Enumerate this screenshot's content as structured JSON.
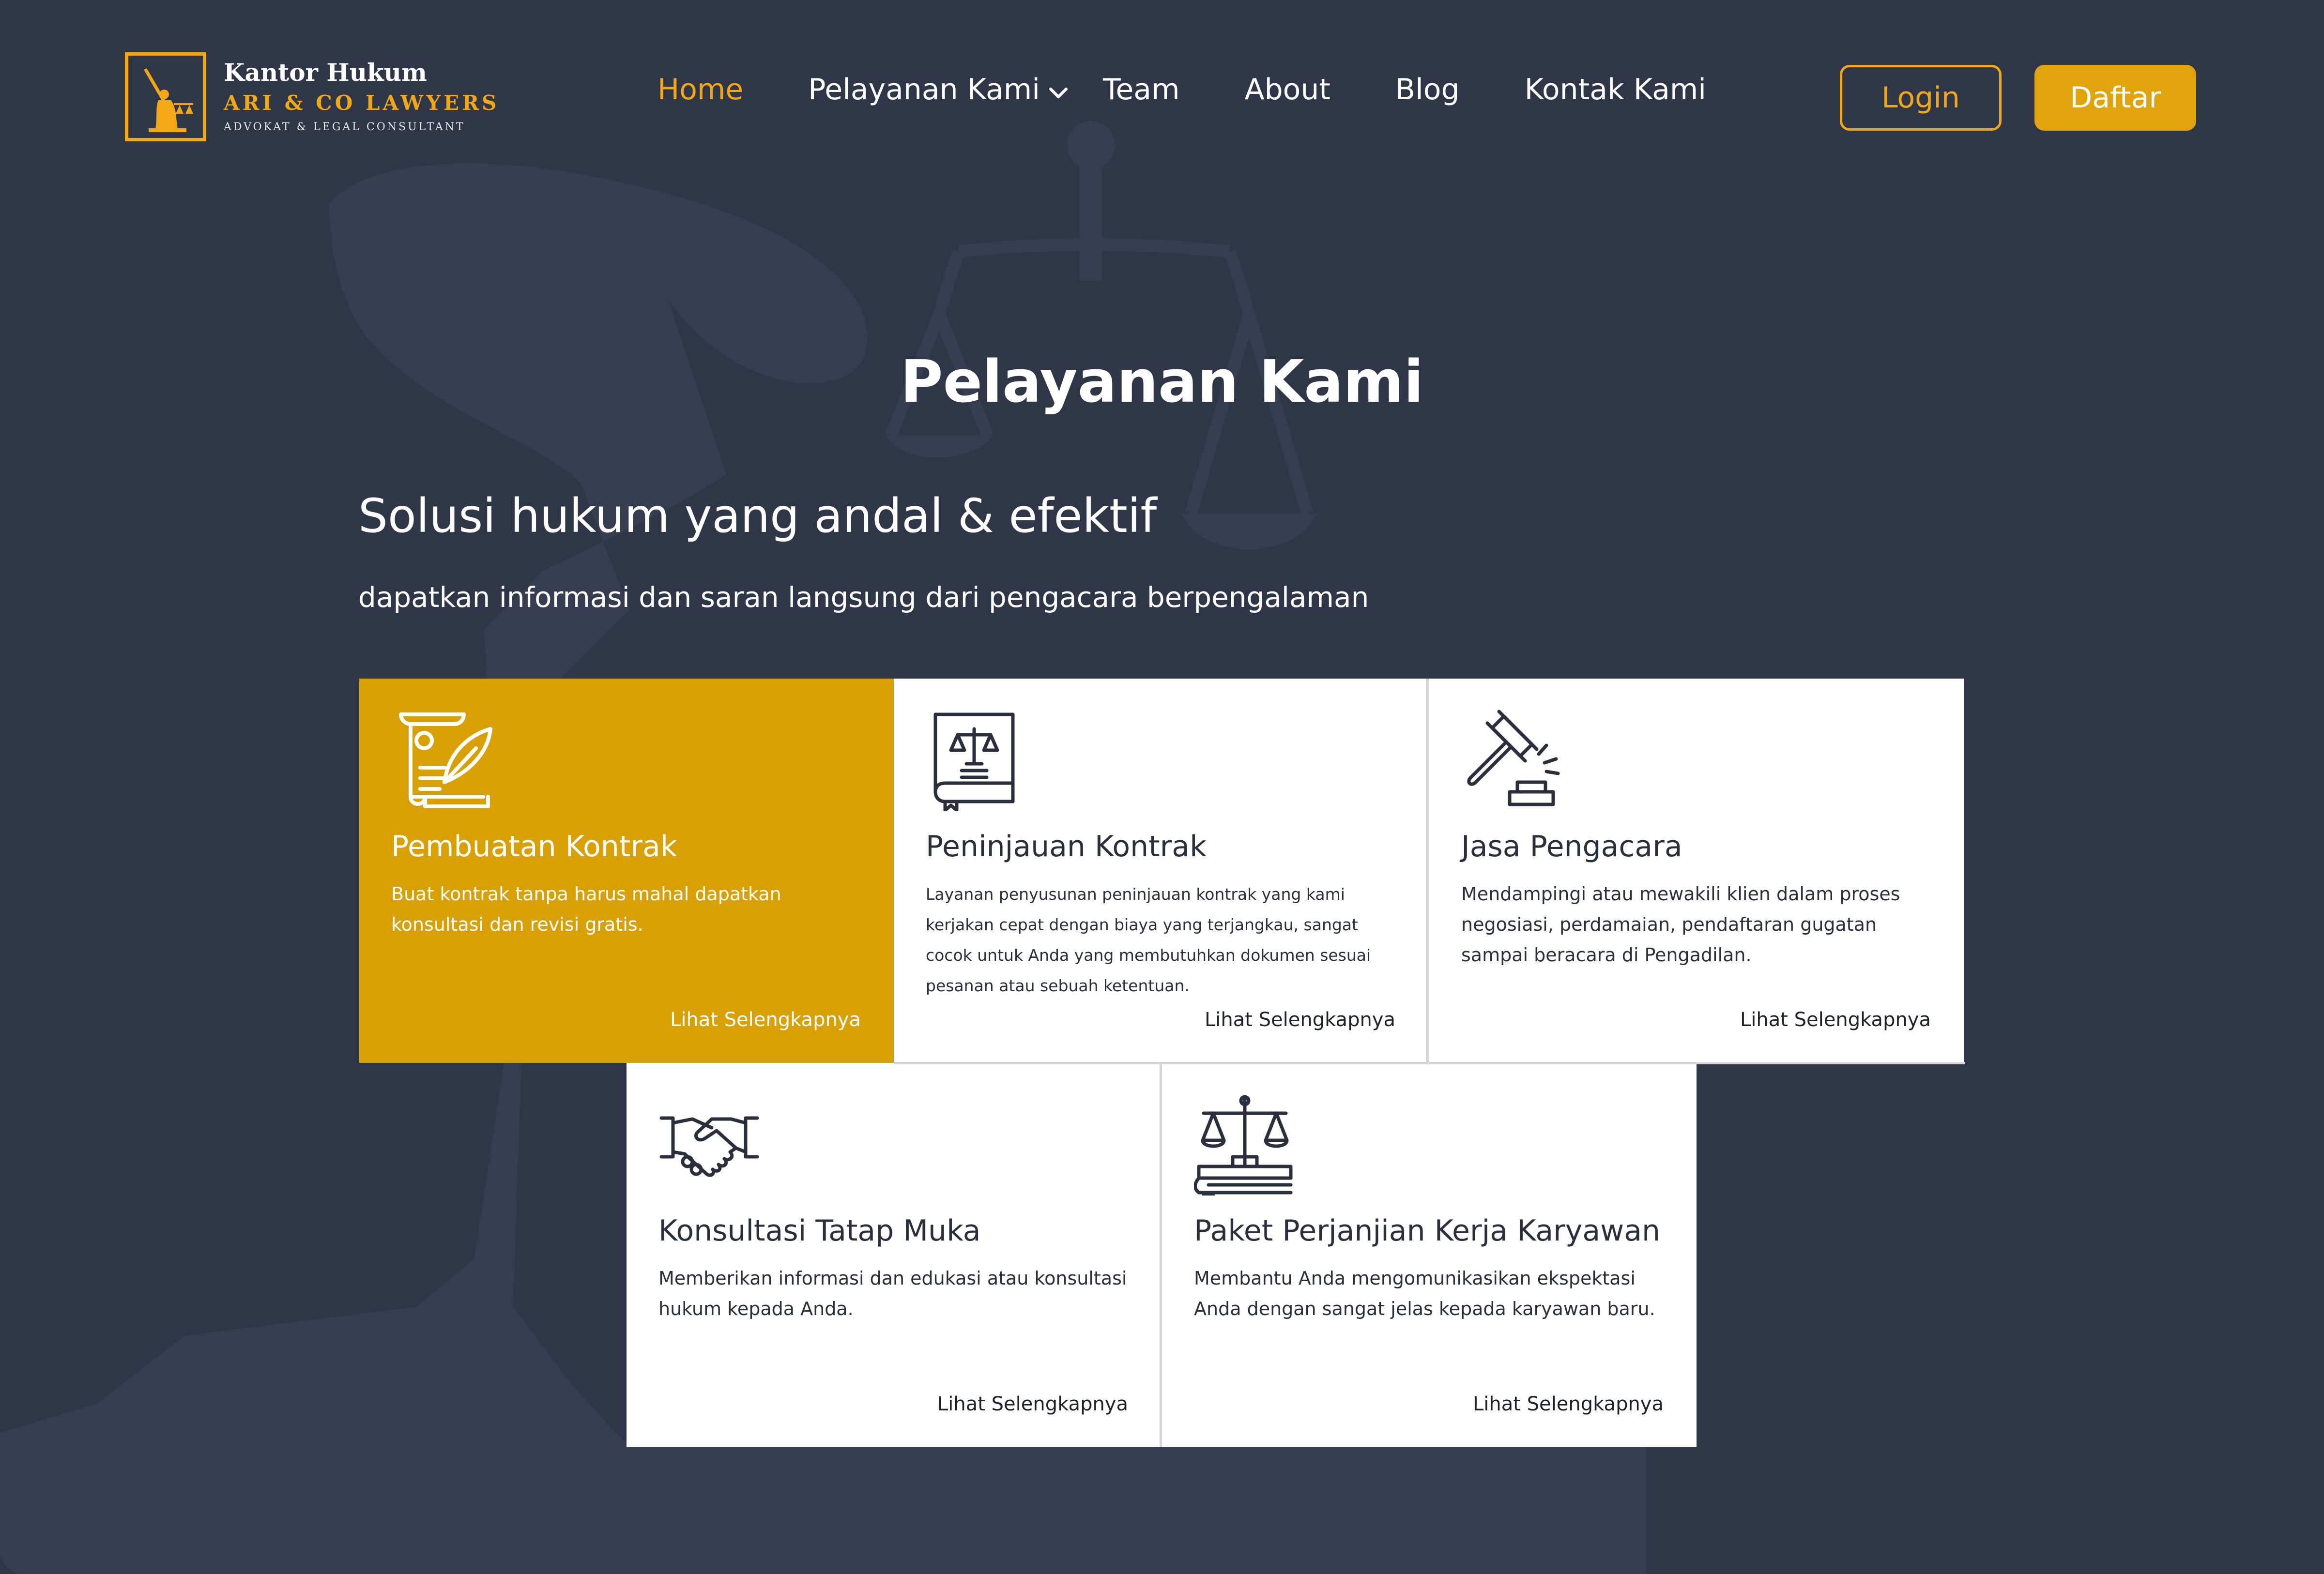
{
  "colors": {
    "background": "#2f3648",
    "accent": "#f1a813",
    "card_highlight": "#d9a004",
    "card_default": "#ffffff",
    "text_dark": "#2a2f3d"
  },
  "logo": {
    "line1": "Kantor Hukum",
    "line2": "ARI & CO LAWYERS",
    "line3": "ADVOKAT & LEGAL CONSULTANT",
    "icon": "lady-justice-icon"
  },
  "nav": {
    "items": [
      {
        "label": "Home",
        "active": true
      },
      {
        "label": "Pelayanan Kami",
        "dropdown": true
      },
      {
        "label": "Team"
      },
      {
        "label": "About"
      },
      {
        "label": "Blog"
      },
      {
        "label": "Kontak Kami"
      }
    ]
  },
  "auth": {
    "login_label": "Login",
    "register_label": "Daftar"
  },
  "hero": {
    "title": "Pelayanan Kami",
    "subtitle": "Solusi hukum yang andal & efektif",
    "description": "dapatkan informasi dan saran langsung dari pengacara berpengalaman"
  },
  "services": [
    {
      "icon": "contract-quill-icon",
      "title": "Pembuatan Kontrak",
      "text": "Buat kontrak tanpa harus mahal dapatkan konsultasi dan revisi gratis.",
      "link": "Lihat Selengkapnya",
      "highlight": true
    },
    {
      "icon": "law-book-icon",
      "title": "Peninjauan Kontrak",
      "text": "Layanan penyusunan peninjauan kontrak yang kami kerjakan cepat dengan biaya yang terjangkau,  sangat cocok untuk Anda yang membutuhkan dokumen sesuai pesanan atau sebuah ketentuan.",
      "link": "Lihat Selengkapnya"
    },
    {
      "icon": "gavel-icon",
      "title": "Jasa Pengacara",
      "text": "Mendampingi atau mewakili klien dalam proses negosiasi, perdamaian, pendaftaran gugatan sampai beracara di Pengadilan.",
      "link": "Lihat Selengkapnya"
    },
    {
      "icon": "handshake-icon",
      "title": "Konsultasi Tatap Muka",
      "text": "Memberikan informasi dan edukasi atau konsultasi hukum kepada Anda.",
      "link": "Lihat Selengkapnya"
    },
    {
      "icon": "scales-on-books-icon",
      "title": "Paket Perjanjian Kerja Karyawan",
      "text": "Membantu Anda mengomunikasikan ekspektasi Anda dengan sangat jelas kepada karyawan baru.",
      "link": "Lihat Selengkapnya"
    }
  ]
}
